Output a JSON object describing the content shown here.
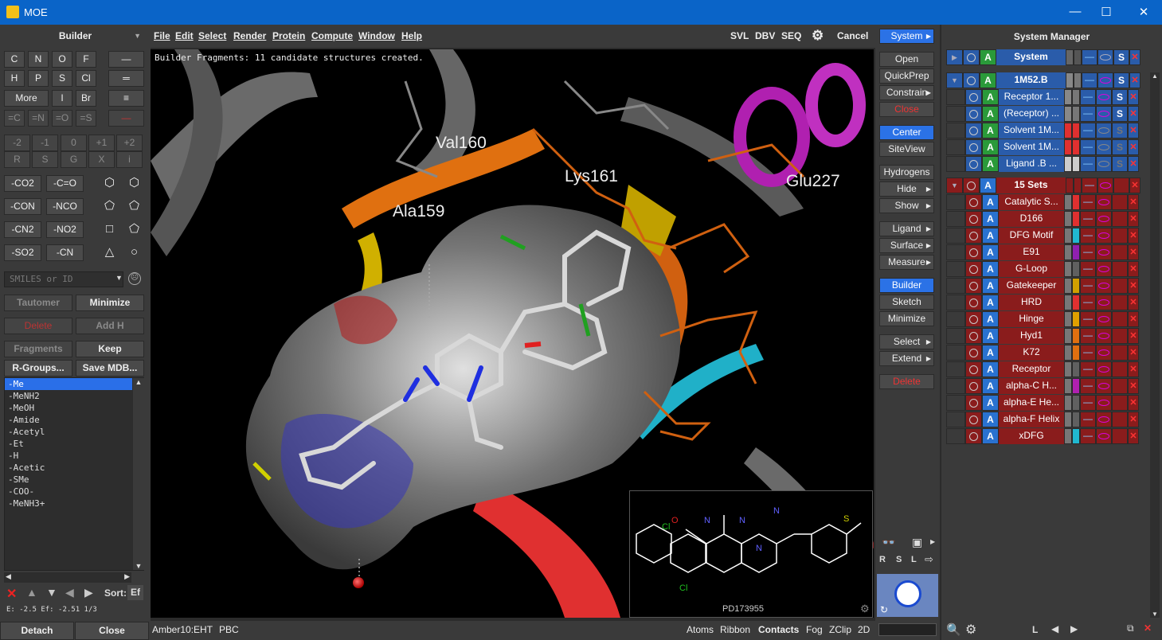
{
  "window": {
    "title": "MOE",
    "min": "—",
    "max": "☐",
    "close": "✕"
  },
  "builder": {
    "header": "Builder",
    "atoms": [
      "C",
      "N",
      "O",
      "F",
      "H",
      "P",
      "S",
      "Cl",
      "More",
      "I",
      "Br"
    ],
    "multi": [
      "=C",
      "=N",
      "=O",
      "=S"
    ],
    "charges": [
      "-2",
      "-1",
      "0",
      "+1",
      "+2"
    ],
    "queries": [
      "R",
      "S",
      "G",
      "X",
      "i"
    ],
    "groups": [
      "-CO2",
      "-C=O",
      "-CON",
      "-NCO",
      "-CN2",
      "-NO2",
      "-SO2",
      "-CN"
    ],
    "smiles_placeholder": "SMILES or ID",
    "tautomer": "Tautomer",
    "minimize": "Minimize",
    "delete": "Delete",
    "addh": "Add H",
    "fragments": "Fragments",
    "keep": "Keep",
    "rgroups": "R-Groups...",
    "savemdb": "Save MDB...",
    "rgroup_list": [
      "-Me",
      "-MeNH2",
      "-MeOH",
      "-Amide",
      "-Acetyl",
      "-Et",
      "-H",
      "-Acetic",
      "-SMe",
      "-COO-",
      "-MeNH3+"
    ],
    "sort": "Sort:",
    "sort_key": "Ef",
    "energy": "E: -2.5 Ef: -2.51 1/3",
    "detach": "Detach",
    "close": "Close"
  },
  "menu": {
    "items": [
      "File",
      "Edit",
      "Select",
      "Render",
      "Protein",
      "Compute",
      "Window",
      "Help"
    ],
    "right": [
      "SVL",
      "DBV",
      "SEQ"
    ],
    "cancel": "Cancel"
  },
  "viewport": {
    "message": "Builder Fragments: 11 candidate structures created.",
    "labels": [
      "Val160",
      "Lys161",
      "Ala159",
      "Glu227"
    ],
    "inset_label": "PD173955"
  },
  "status": {
    "forcefield": "Amber10:EHT",
    "pbc": "PBC",
    "right": [
      "Atoms",
      "Ribbon",
      "Contacts",
      "Fog",
      "ZClip",
      "2D"
    ]
  },
  "side": {
    "system": "System",
    "open": "Open",
    "quickprep": "QuickPrep",
    "constrain": "Constrain",
    "close": "Close",
    "center": "Center",
    "siteview": "SiteView",
    "hydrogens": "Hydrogens",
    "hide": "Hide",
    "show": "Show",
    "ligand": "Ligand",
    "surface": "Surface",
    "measure": "Measure",
    "builder": "Builder",
    "sketch": "Sketch",
    "minimize": "Minimize",
    "select": "Select",
    "extend": "Extend",
    "delete": "Delete",
    "rsl": [
      "R",
      "S",
      "L"
    ]
  },
  "sysman": {
    "header": "System Manager",
    "system_row": "System",
    "chain": "1M52.B",
    "chain_items": [
      "Receptor 1...",
      "(Receptor) ...",
      "Solvent 1M...",
      "Solvent 1M...",
      "Ligand .B ..."
    ],
    "sets_header": "15 Sets",
    "sets": [
      "Catalytic S...",
      "D166",
      "DFG Motif",
      "E91",
      "G-Loop",
      "Gatekeeper",
      "HRD",
      "Hinge",
      "Hyd1",
      "K72",
      "Receptor",
      "alpha-C H...",
      "alpha-E He...",
      "alpha-F Helix",
      "xDFG"
    ],
    "set_colors": [
      "#e03030",
      "#e03030",
      "#20b8d0",
      "#9020b0",
      "#606060",
      "#d0a000",
      "#e03030",
      "#e0a000",
      "#e07010",
      "#e07010",
      "#606060",
      "#b020b0",
      "#606060",
      "#606060",
      "#20b8d0"
    ],
    "bottom_L": "L"
  }
}
